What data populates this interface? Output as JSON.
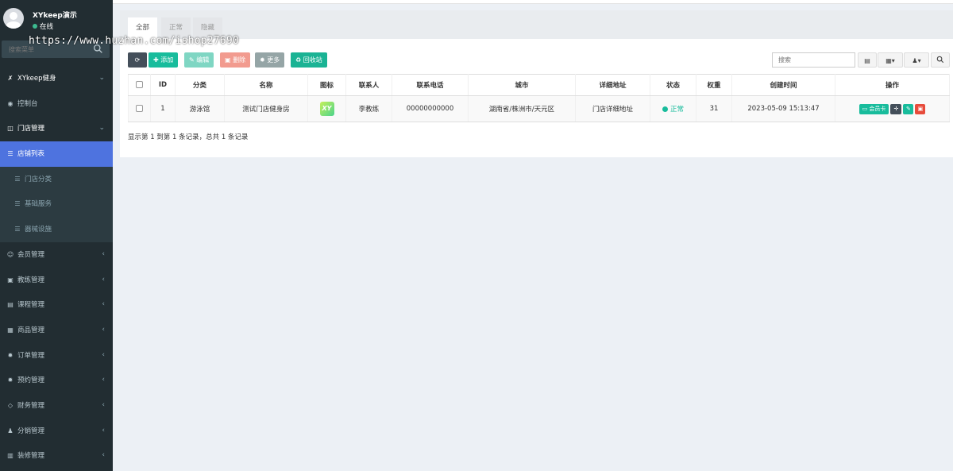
{
  "user": {
    "name": "XYkeep演示",
    "status": "在线"
  },
  "sidebar": {
    "search_placeholder": "搜索菜单",
    "items": [
      {
        "label": "XYkeep健身",
        "icon": "lightning-icon",
        "glyph": "✗",
        "kind": "header",
        "arrow": "⌄"
      },
      {
        "label": "控制台",
        "icon": "dashboard-icon",
        "glyph": "◉",
        "kind": "item",
        "arrow": ""
      },
      {
        "label": "门店管理",
        "icon": "store-icon",
        "glyph": "◫",
        "kind": "open",
        "arrow": "⌄"
      },
      {
        "label": "店铺列表",
        "icon": "list-icon",
        "glyph": "☰",
        "kind": "active",
        "arrow": ""
      },
      {
        "label": "门店分类",
        "icon": "list-icon",
        "glyph": "☰",
        "kind": "sub",
        "arrow": ""
      },
      {
        "label": "基础服务",
        "icon": "list-icon",
        "glyph": "☰",
        "kind": "sub",
        "arrow": ""
      },
      {
        "label": "器械设施",
        "icon": "list-icon",
        "glyph": "☰",
        "kind": "sub",
        "arrow": ""
      },
      {
        "label": "会员管理",
        "icon": "user-circle-icon",
        "glyph": "☺",
        "kind": "item",
        "arrow": "‹"
      },
      {
        "label": "教练管理",
        "icon": "id-card-icon",
        "glyph": "▣",
        "kind": "item",
        "arrow": "‹"
      },
      {
        "label": "课程管理",
        "icon": "course-icon",
        "glyph": "▤",
        "kind": "item",
        "arrow": "‹"
      },
      {
        "label": "商品管理",
        "icon": "goods-icon",
        "glyph": "▦",
        "kind": "item",
        "arrow": "‹"
      },
      {
        "label": "订单管理",
        "icon": "gear-icon",
        "glyph": "✹",
        "kind": "item",
        "arrow": "‹"
      },
      {
        "label": "预约管理",
        "icon": "gear-icon",
        "glyph": "✹",
        "kind": "item",
        "arrow": "‹"
      },
      {
        "label": "财务管理",
        "icon": "diamond-icon",
        "glyph": "◇",
        "kind": "item",
        "arrow": "‹"
      },
      {
        "label": "分销管理",
        "icon": "users-icon",
        "glyph": "♟",
        "kind": "item",
        "arrow": "‹"
      },
      {
        "label": "装修管理",
        "icon": "image-icon",
        "glyph": "▥",
        "kind": "item",
        "arrow": "‹"
      }
    ]
  },
  "watermark": "https://www.huzhan.com/ishop27690",
  "tabs": [
    {
      "label": "全部",
      "active": true
    },
    {
      "label": "正常",
      "active": false
    },
    {
      "label": "隐藏",
      "active": false
    }
  ],
  "toolbar": {
    "refresh_glyph": "⟳",
    "add": "添加",
    "edit": "编辑",
    "delete": "删除",
    "more": "更多",
    "recycle": "回收站",
    "search_placeholder": "搜索"
  },
  "table": {
    "headers": [
      "ID",
      "分类",
      "名称",
      "图标",
      "联系人",
      "联系电话",
      "城市",
      "详细地址",
      "状态",
      "权重",
      "创建时间",
      "操作"
    ],
    "rows": [
      {
        "id": "1",
        "category": "游泳馆",
        "name": "测试门店健身房",
        "logo_text": "XY",
        "contact": "李教练",
        "phone": "00000000000",
        "city": "湖南省/株洲市/天元区",
        "address": "门店详细地址",
        "status": "正常",
        "weight": "31",
        "created": "2023-05-09 15:13:47",
        "op_card": "会员卡"
      }
    ]
  },
  "pager_info": "显示第 1 到第 1 条记录，总共 1 条记录",
  "colors": {
    "sidebar_bg": "#222d32",
    "active": "#4e73df",
    "success": "#18bc9c",
    "danger": "#e74c3c"
  }
}
